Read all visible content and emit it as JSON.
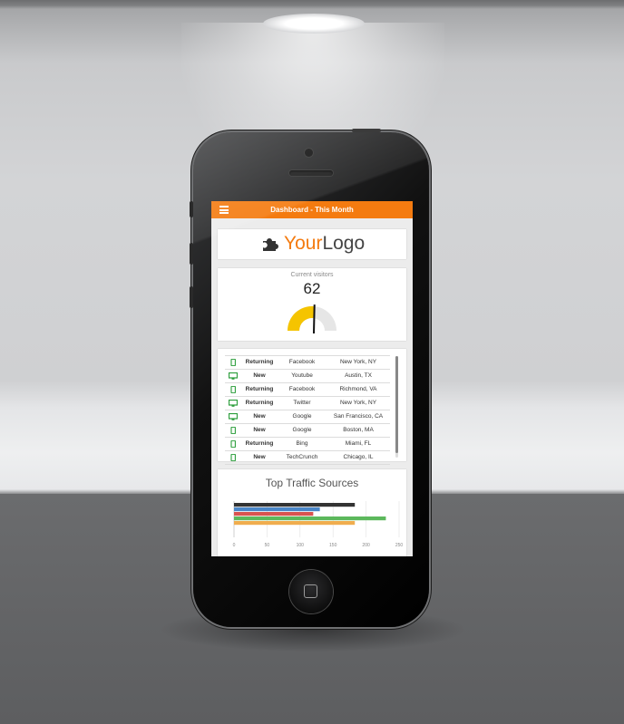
{
  "screen": {
    "header": {
      "title": "Dashboard - This Month",
      "menu_icon": "hamburger-icon"
    },
    "logo": {
      "part1": "Your",
      "part2": "Logo",
      "icon": "puzzle-piece-icon"
    },
    "gauge": {
      "label": "Current visitors",
      "value": "62",
      "fill_fraction": 0.53,
      "color": "#f5c400",
      "track_color": "#e6e6e6"
    },
    "visitors": [
      {
        "device": "mobile-icon",
        "type": "Returning",
        "source": "Facebook",
        "location": "New York, NY"
      },
      {
        "device": "desktop-icon",
        "type": "New",
        "source": "Youtube",
        "location": "Austin, TX"
      },
      {
        "device": "mobile-icon",
        "type": "Returning",
        "source": "Facebook",
        "location": "Richmond, VA"
      },
      {
        "device": "desktop-icon",
        "type": "Returning",
        "source": "Twitter",
        "location": "New York, NY"
      },
      {
        "device": "desktop-icon",
        "type": "New",
        "source": "Google",
        "location": "San Francisco, CA"
      },
      {
        "device": "mobile-icon",
        "type": "New",
        "source": "Google",
        "location": "Boston, MA"
      },
      {
        "device": "mobile-icon",
        "type": "Returning",
        "source": "Bing",
        "location": "Miami, FL"
      },
      {
        "device": "mobile-icon",
        "type": "New",
        "source": "TechCrunch",
        "location": "Chicago, IL"
      }
    ],
    "device_icon_color": "#2a9d3a",
    "accent": "#f47b10"
  },
  "chart_data": {
    "type": "bar",
    "orientation": "horizontal",
    "title": "Top Traffic Sources",
    "xlim": [
      0,
      250
    ],
    "xticks": [
      "0",
      "50",
      "100",
      "150",
      "200",
      "250"
    ],
    "grid": true,
    "series": [
      {
        "color": "#333333",
        "values": [
          183
        ]
      },
      {
        "color": "#4a86c8",
        "values": [
          130
        ]
      },
      {
        "color": "#d9534f",
        "values": [
          120
        ]
      },
      {
        "color": "#5cb85c",
        "values": [
          230
        ]
      },
      {
        "color": "#f0ad4e",
        "values": [
          183
        ]
      }
    ],
    "legend_placement": "bottom"
  }
}
